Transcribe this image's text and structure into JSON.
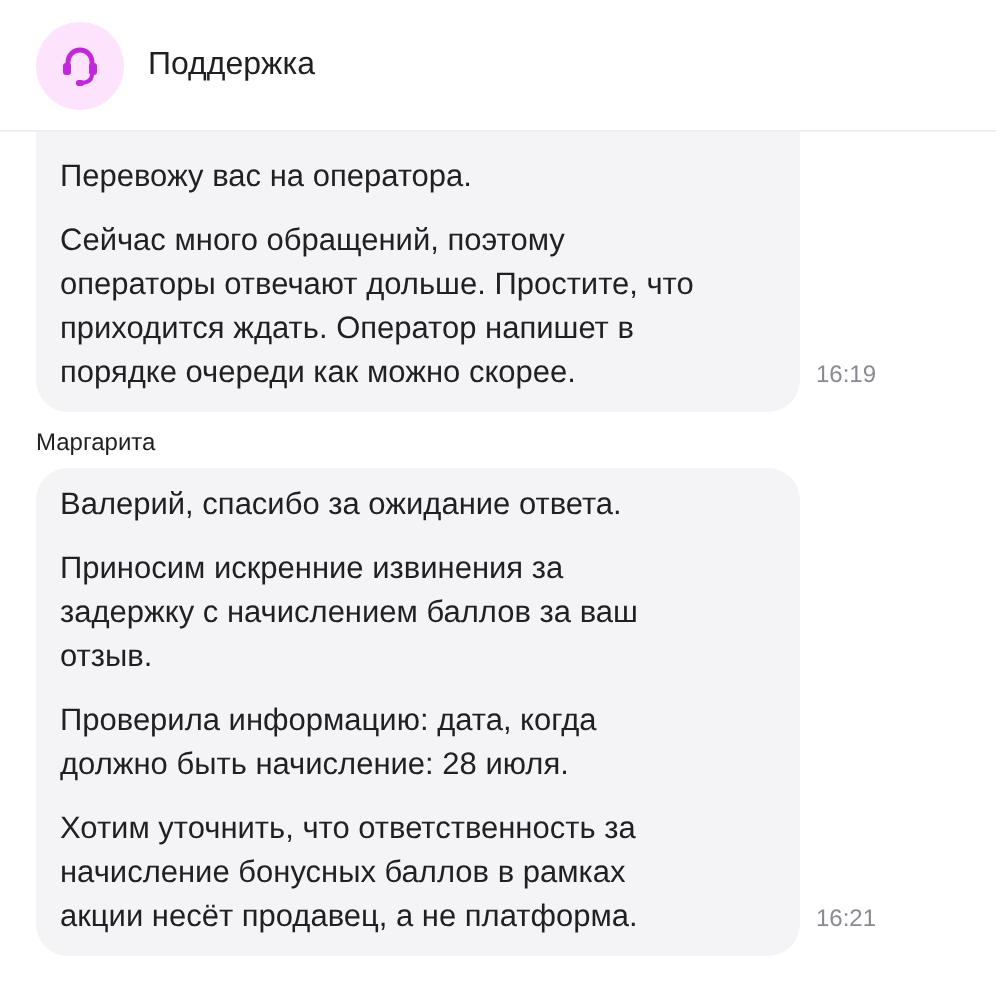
{
  "header": {
    "title": "Поддержка"
  },
  "messages": [
    {
      "time": "16:19",
      "paragraphs": [
        "Перевожу вас на оператора.",
        "Сейчас много обращений, поэтому операторы отвечают дольше. Простите, что приходится ждать. Оператор напишет в порядке очереди как можно скорее."
      ]
    },
    {
      "sender": "Маргарита",
      "time": "16:21",
      "paragraphs": [
        "Валерий, спасибо за ожидание ответа.",
        "Приносим искренние извинения за задержку с начислением баллов за ваш отзыв.",
        "Проверила информацию: дата, когда должно быть начисление: 28 июля.",
        "Хотим уточнить, что ответственность за начисление бонусных баллов в рамках акции несёт продавец, а не платформа."
      ]
    }
  ]
}
